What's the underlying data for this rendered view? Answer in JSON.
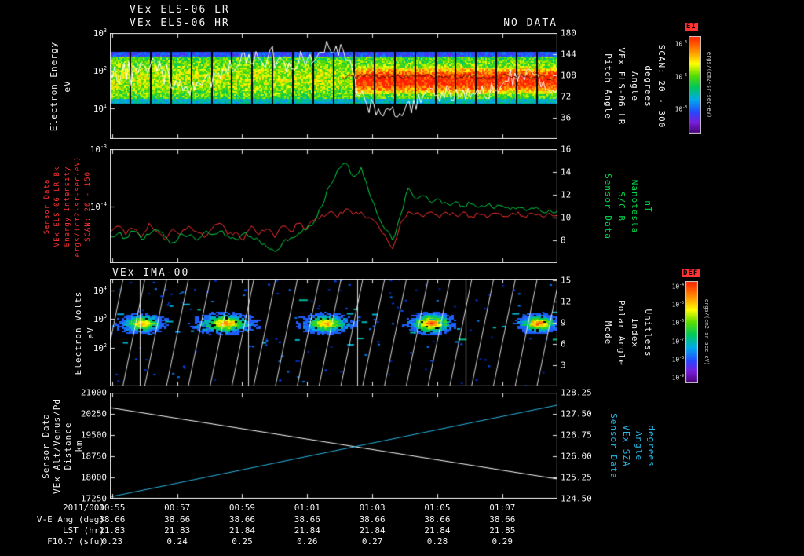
{
  "colors": {
    "background": "#000000",
    "text": "#f0f0f0",
    "red_label": "#ff3333",
    "green_label": "#00d84a",
    "cyan_label": "#2ab8e8"
  },
  "titles": {
    "els_lr": "VEx ELS-06 LR",
    "els_hr": "VEx ELS-06 HR",
    "no_data": "NO DATA",
    "ima": "VEx IMA-00"
  },
  "time_axis": {
    "date": "2011/001",
    "ticks": [
      "00:55",
      "00:57",
      "00:59",
      "01:01",
      "01:03",
      "01:05",
      "01:07"
    ],
    "first_frac": 0.005,
    "step_frac": 0.1453
  },
  "info_rows": [
    {
      "label": "V-E Ang (deg)",
      "values": [
        "38.66",
        "38.66",
        "38.66",
        "38.66",
        "38.66",
        "38.66",
        "38.66"
      ]
    },
    {
      "label": "LST (hr)",
      "values": [
        "21.83",
        "21.83",
        "21.84",
        "21.84",
        "21.84",
        "21.84",
        "21.85"
      ]
    },
    {
      "label": "F10.7 (sfu)",
      "values": [
        "0.23",
        "0.24",
        "0.25",
        "0.26",
        "0.27",
        "0.28",
        "0.29"
      ]
    }
  ],
  "colorbars": [
    {
      "label": "EI",
      "unit": "ergs/(cm2-sr-sec-eV)",
      "ticks": [
        {
          "label": "10^-4",
          "frac": 0.083
        },
        {
          "label": "10^-6",
          "frac": 0.417
        },
        {
          "label": "10^-8",
          "frac": 0.75
        }
      ]
    },
    {
      "label": "DEF",
      "unit": "ergs/(cm2-sr-sec-eV)",
      "ticks": [
        {
          "label": "10^-4",
          "frac": 0.054
        },
        {
          "label": "10^-5",
          "frac": 0.232
        },
        {
          "label": "10^-6",
          "frac": 0.411
        },
        {
          "label": "10^-7",
          "frac": 0.589
        },
        {
          "label": "10^-8",
          "frac": 0.768
        },
        {
          "label": "10^-9",
          "frac": 0.946
        }
      ]
    }
  ],
  "chart_data": [
    {
      "id": "els_pitch_angle_spectrogram",
      "type": "heatmap",
      "left_axis": {
        "scale": "log",
        "color": "#f0f0f0",
        "title_lines": [
          "Electron Energy",
          "eV"
        ],
        "ticks": [
          {
            "label": "10^3",
            "frac": 0.0
          },
          {
            "label": "10^2",
            "frac": 0.357
          },
          {
            "label": "10^1",
            "frac": 0.714
          }
        ]
      },
      "right_axis": {
        "scale": "linear",
        "range": [
          0,
          180
        ],
        "color": "#f0f0f0",
        "title_lines": [
          "Pitch Angle",
          "VEx ELS-06 LR",
          "Angle",
          "degrees",
          "SCAN: 20 - 300"
        ],
        "ticks": [
          {
            "label": "180",
            "frac": 0.0
          },
          {
            "label": "144",
            "frac": 0.2
          },
          {
            "label": "108",
            "frac": 0.4
          },
          {
            "label": "72",
            "frac": 0.6
          },
          {
            "label": "36",
            "frac": 0.8
          }
        ]
      },
      "heat": {
        "band_top_frac": 0.18,
        "band_bot_frac": 0.66,
        "segments": 22,
        "enhanced_from_frac": 0.55,
        "seed": 7
      }
    },
    {
      "id": "energy_intensity_and_bfield",
      "type": "line",
      "left_axis": {
        "scale": "log",
        "range_exp": [
          -5,
          -3
        ],
        "color": "#ff3333",
        "title_lines": [
          "Sensor Data",
          "VEx ELS-06 LR Bk",
          "Energy Intensity",
          "ergs/(cm2-sr-sec-eV)",
          "SCAN: 20 - 150"
        ],
        "ticks": [
          {
            "label": "10^-3",
            "frac": 0.0
          },
          {
            "label": "10^-4",
            "frac": 0.5
          }
        ]
      },
      "right_axis": {
        "scale": "linear",
        "range": [
          6,
          16
        ],
        "color": "#00d84a",
        "title_lines": [
          "Sensor Data",
          "S/C B",
          "Nanotesla",
          "nT"
        ],
        "ticks": [
          {
            "label": "16",
            "frac": 0.0
          },
          {
            "label": "14",
            "frac": 0.2
          },
          {
            "label": "12",
            "frac": 0.4
          },
          {
            "label": "10",
            "frac": 0.6
          },
          {
            "label": "8",
            "frac": 0.8
          }
        ]
      },
      "series": [
        {
          "name": "energy_intensity",
          "axis": "left",
          "color": "#ff3333",
          "log_values": [
            -4.45,
            -4.35,
            -4.5,
            -4.4,
            -4.55,
            -4.3,
            -4.45,
            -4.6,
            -4.4,
            -4.5,
            -4.35,
            -4.45,
            -4.55,
            -4.4,
            -4.3,
            -4.5,
            -4.45,
            -4.6,
            -4.35,
            -4.5,
            -4.4,
            -4.55,
            -4.35,
            -4.45,
            -4.3,
            -4.4,
            -4.25,
            -4.15,
            -4.1,
            -4.2,
            -4.05,
            -4.15,
            -4.1,
            -4.2,
            -4.3,
            -4.5,
            -4.75,
            -4.3,
            -4.1,
            -4.12,
            -4.18,
            -4.1,
            -4.2,
            -4.12,
            -4.16,
            -4.1,
            -4.18,
            -4.14,
            -4.2,
            -4.12,
            -4.18,
            -4.15,
            -4.1,
            -4.2,
            -4.14,
            -4.18,
            -4.12,
            -4.16
          ]
        },
        {
          "name": "sc_b_field",
          "axis": "right",
          "color": "#00d84a",
          "values": [
            8.4,
            8.6,
            8.2,
            8.8,
            8.1,
            8.5,
            8.9,
            8.3,
            7.8,
            8.6,
            8.4,
            8.0,
            8.7,
            8.5,
            8.8,
            8.4,
            8.1,
            8.6,
            8.3,
            8.0,
            7.4,
            7.0,
            7.8,
            8.2,
            8.6,
            8.9,
            9.6,
            11.0,
            12.8,
            14.2,
            14.8,
            13.6,
            14.4,
            12.2,
            10.4,
            9.0,
            8.0,
            10.2,
            12.6,
            11.6,
            11.9,
            11.3,
            11.6,
            11.2,
            11.4,
            11.0,
            11.2,
            10.9,
            11.1,
            10.8,
            11.0,
            10.7,
            10.9,
            10.6,
            10.8,
            10.5,
            10.7,
            10.6
          ]
        }
      ]
    },
    {
      "id": "ima_spectrogram",
      "type": "heatmap",
      "left_axis": {
        "scale": "log",
        "color": "#f0f0f0",
        "title_lines": [
          "Electron Volts",
          "eV"
        ],
        "ticks": [
          {
            "label": "10^4",
            "frac": 0.107
          },
          {
            "label": "10^3",
            "frac": 0.373
          },
          {
            "label": "10^2",
            "frac": 0.64
          }
        ]
      },
      "right_axis": {
        "scale": "linear",
        "range": [
          0,
          15.2
        ],
        "color": "#f0f0f0",
        "title_lines": [
          "Mode",
          "Polar Angle",
          "Index",
          "Unitless"
        ],
        "ticks": [
          {
            "label": "15",
            "frac": 0.013
          },
          {
            "label": "12",
            "frac": 0.21
          },
          {
            "label": "9",
            "frac": 0.408
          },
          {
            "label": "6",
            "frac": 0.605
          },
          {
            "label": "3",
            "frac": 0.803
          }
        ]
      },
      "heat": {
        "blob_centers_frac": [
          0.07,
          0.255,
          0.48,
          0.715,
          0.955
        ],
        "blob_y_frac": 0.41,
        "segment_lines_frac": [
          0.0667,
          0.3096,
          0.5526,
          0.7956
        ],
        "sawtooth_period_frac": 0.0487,
        "seed": 11
      }
    },
    {
      "id": "altitude_and_sza",
      "type": "line",
      "left_axis": {
        "scale": "linear",
        "range": [
          17250,
          21000
        ],
        "color": "#f0f0f0",
        "title_lines": [
          "Sensor Data",
          "VEx Alt/Venus/Pd",
          "Distance",
          "km"
        ],
        "ticks": [
          {
            "label": "21000",
            "frac": 0.0
          },
          {
            "label": "20250",
            "frac": 0.2
          },
          {
            "label": "19500",
            "frac": 0.4
          },
          {
            "label": "18750",
            "frac": 0.6
          },
          {
            "label": "18000",
            "frac": 0.8
          },
          {
            "label": "17250",
            "frac": 1.0
          }
        ]
      },
      "right_axis": {
        "scale": "linear",
        "range": [
          124.5,
          128.25
        ],
        "color": "#2ab8e8",
        "title_lines": [
          "Sensor Data",
          "VEx SZA",
          "Angle",
          "degrees"
        ],
        "ticks": [
          {
            "label": "128.25",
            "frac": 0.0
          },
          {
            "label": "127.50",
            "frac": 0.2
          },
          {
            "label": "126.75",
            "frac": 0.4
          },
          {
            "label": "126.00",
            "frac": 0.6
          },
          {
            "label": "125.25",
            "frac": 0.8
          },
          {
            "label": "124.50",
            "frac": 1.0
          }
        ]
      },
      "series": [
        {
          "name": "vex_altitude_km",
          "axis": "left",
          "color": "#ffffff",
          "values": [
            20470,
            17944
          ]
        },
        {
          "name": "vex_sza_deg",
          "axis": "right",
          "color": "#2ab8e8",
          "values": [
            124.56,
            127.81
          ]
        }
      ]
    }
  ]
}
